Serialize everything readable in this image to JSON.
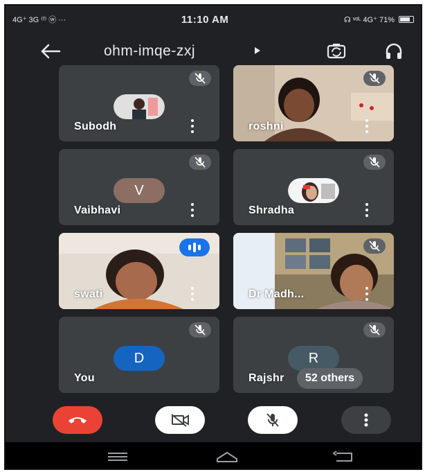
{
  "status_bar": {
    "left_text": "4G⁺ 3G ⁽ᶠ⁾ ⓦ ···",
    "time": "11:10 AM",
    "right_text": "☊ ᵛᵒᴸ 4G⁺ 71%"
  },
  "header": {
    "meeting_code": "ohm-imqe-zxj"
  },
  "participants": [
    {
      "name": "Subodh",
      "type": "photo",
      "muted": true
    },
    {
      "name": "roshni",
      "type": "video",
      "muted": true
    },
    {
      "name": "Vaibhavi",
      "type": "initial",
      "initial": "V",
      "color": "#8d6e63",
      "muted": true
    },
    {
      "name": "Shradha",
      "type": "photo",
      "muted": true
    },
    {
      "name": "swati",
      "type": "video",
      "muted": false,
      "speaking": true
    },
    {
      "name": "Dr Madh...",
      "type": "video",
      "muted": true
    },
    {
      "name": "You",
      "type": "initial",
      "initial": "D",
      "color": "#1565c0",
      "muted": true
    },
    {
      "name": "Rajshr",
      "type": "initial",
      "initial": "R",
      "color": "#455a64",
      "muted": true
    }
  ],
  "others_label": "52 others",
  "colors": {
    "background": "#202124",
    "tile": "#3c4043",
    "end_call": "#ea4335",
    "speaking": "#1a73e8"
  }
}
